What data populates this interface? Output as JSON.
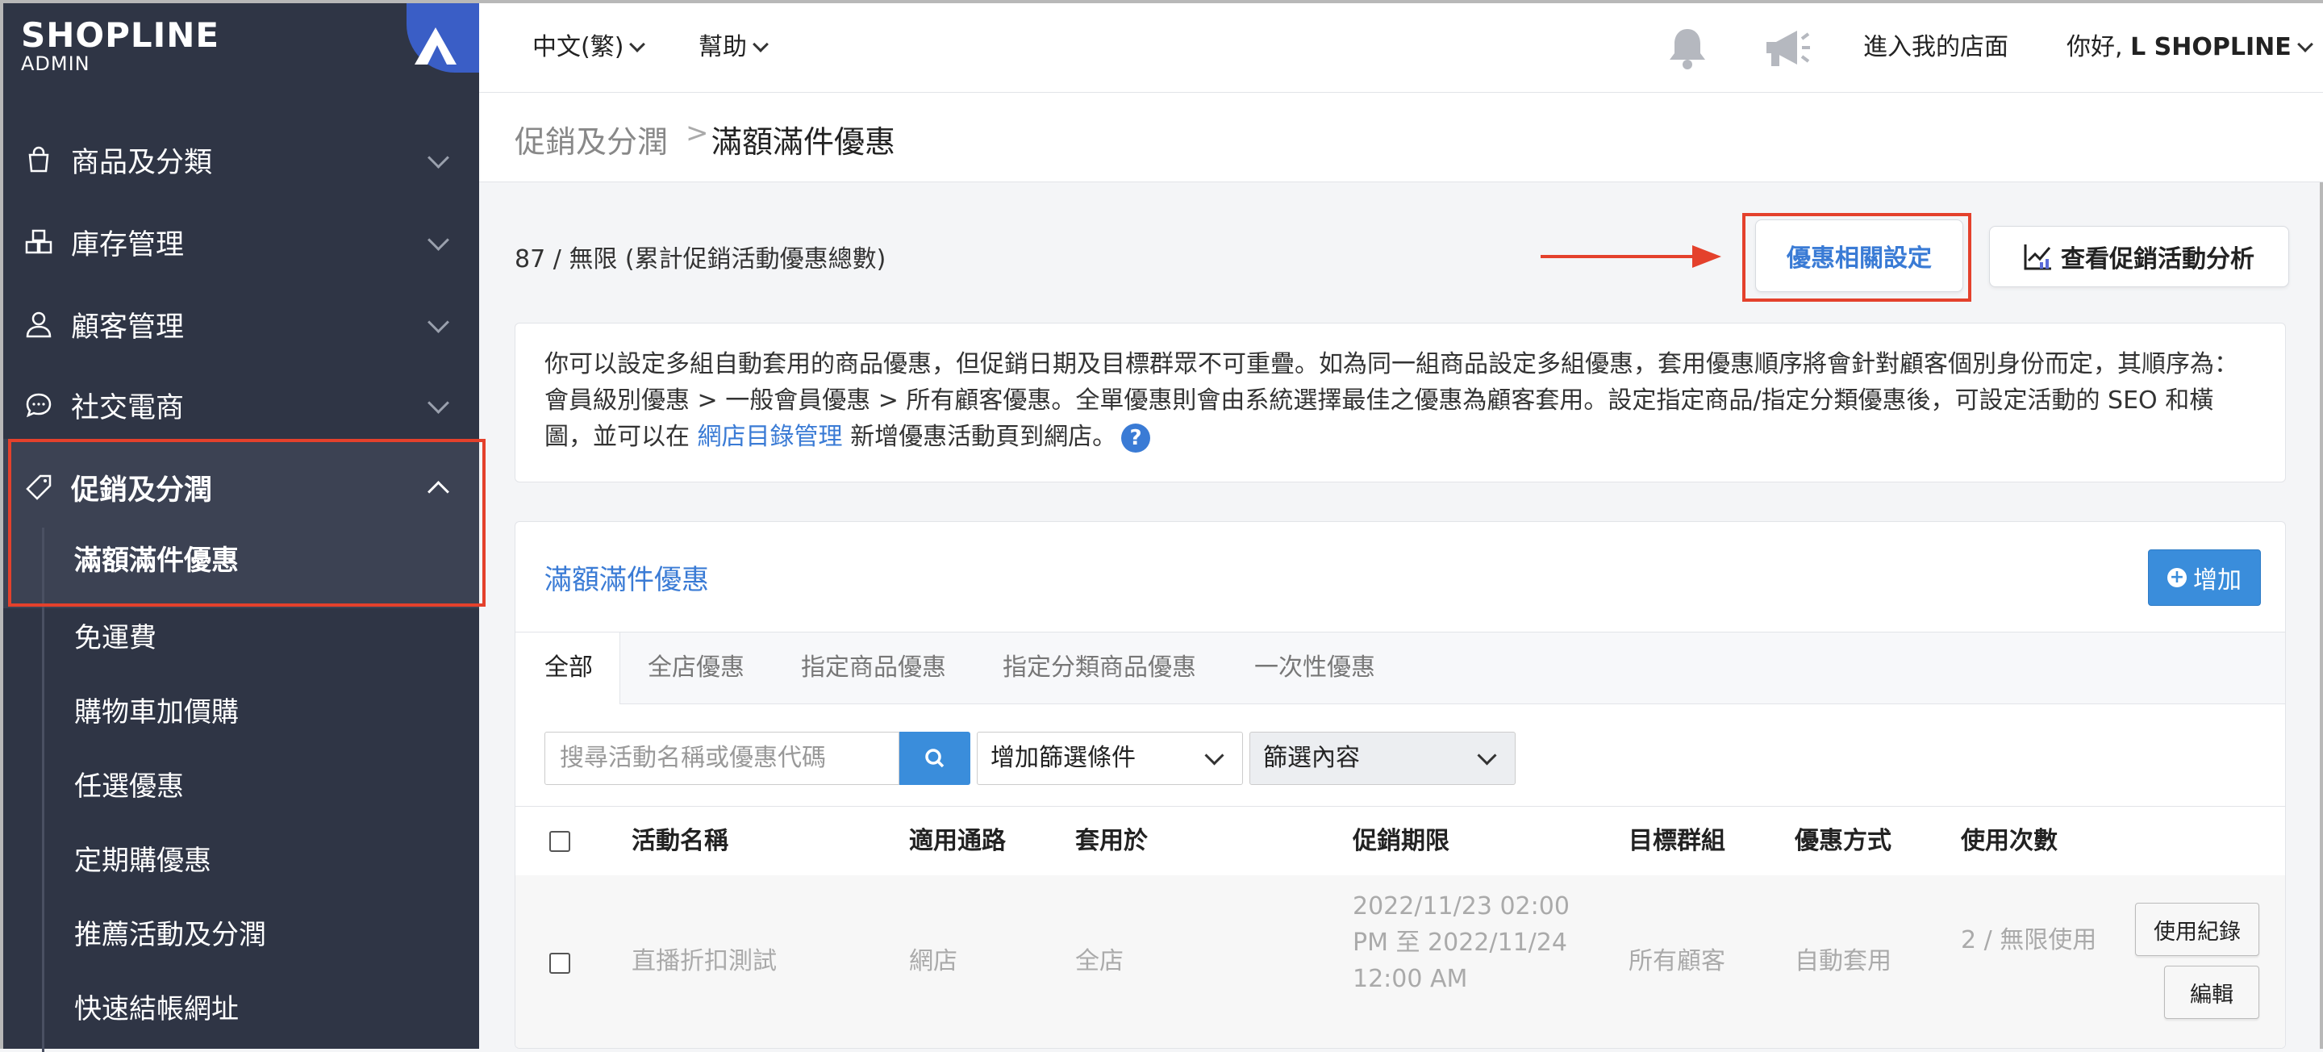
{
  "sidebar": {
    "logo_brand": "SHOPLINE",
    "logo_sub": "ADMIN",
    "items": [
      {
        "label": "商品及分類",
        "icon": "shopping-bag-icon"
      },
      {
        "label": "庫存管理",
        "icon": "boxes-icon"
      },
      {
        "label": "顧客管理",
        "icon": "user-icon"
      },
      {
        "label": "社交電商",
        "icon": "chat-bubble-icon"
      },
      {
        "label": "促銷及分潤",
        "icon": "tag-icon"
      }
    ],
    "sub_items": [
      "滿額滿件優惠",
      "免運費",
      "購物車加價購",
      "任選優惠",
      "定期購優惠",
      "推薦活動及分潤",
      "快速結帳網址"
    ]
  },
  "topbar": {
    "language": "中文(繁)",
    "help": "幫助",
    "store_link": "進入我的店面",
    "greeting": "你好,",
    "user": "L SHOPLINE"
  },
  "breadcrumb": {
    "parent": "促銷及分潤",
    "separator": ">",
    "current": "滿額滿件優惠"
  },
  "counter": "87 / 無限 (累計促銷活動優惠總數)",
  "buttons": {
    "settings": "優惠相關設定",
    "analysis": "查看促銷活動分析",
    "add": "增加"
  },
  "info": {
    "text": "你可以設定多組自動套用的商品優惠，但促銷日期及目標群眾不可重疊。如為同一組商品設定多組優惠，套用優惠順序將會針對顧客個別身份而定，其順序為：會員級別優惠 > 一般會員優惠 > 所有顧客優惠。全單優惠則會由系統選擇最佳之優惠為顧客套用。設定指定商品/指定分類優惠後，可設定活動的 SEO 和橫圖，並可以在 ",
    "link": "網店目錄管理",
    "suffix": " 新增優惠活動頁到網店。",
    "help_icon": "?"
  },
  "panel": {
    "title": "滿額滿件優惠",
    "tabs": [
      "全部",
      "全店優惠",
      "指定商品優惠",
      "指定分類商品優惠",
      "一次性優惠"
    ],
    "search_placeholder": "搜尋活動名稱或優惠代碼",
    "filter_select": "增加篩選條件",
    "filter_content": "篩選內容"
  },
  "table": {
    "headers": [
      "活動名稱",
      "適用通路",
      "套用於",
      "促銷期限",
      "目標群組",
      "優惠方式",
      "使用次數"
    ],
    "rows": [
      {
        "name": "直播折扣測試",
        "channel": "網店",
        "apply": "全店",
        "period": "2022/11/23 02:00 PM 至 2022/11/24 12:00 AM",
        "target": "所有顧客",
        "method": "自動套用",
        "usage": "2 / 無限使用",
        "btn_log": "使用紀錄",
        "btn_edit": "編輯"
      }
    ]
  },
  "colors": {
    "sidebar_bg": "#2f3545",
    "accent_blue": "#3a7bd5",
    "highlight_red": "#e4412c"
  }
}
